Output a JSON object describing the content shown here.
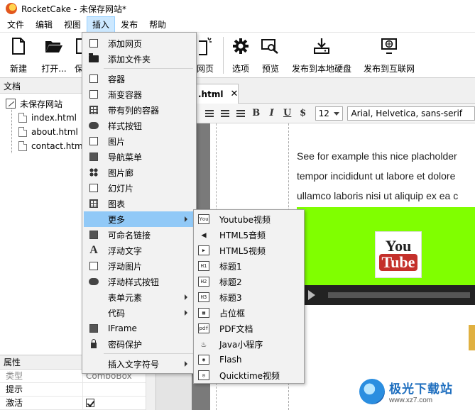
{
  "window": {
    "title": "RocketCake - 未保存网站*"
  },
  "menubar": {
    "items": [
      {
        "label": "文件",
        "active": false
      },
      {
        "label": "编辑",
        "active": false
      },
      {
        "label": "视图",
        "active": false
      },
      {
        "label": "插入",
        "active": true
      },
      {
        "label": "发布",
        "active": false
      },
      {
        "label": "帮助",
        "active": false
      }
    ]
  },
  "toolbar": {
    "new_label": "新建",
    "open_label": "打开...",
    "save_label_partial": "保",
    "webpage_label_partial": "网页",
    "options_label": "选项",
    "preview_label": "预览",
    "publish_local_label": "发布到本地硬盘",
    "publish_web_label": "发布到互联网"
  },
  "documents_panel": {
    "header": "文档",
    "root": "未保存网站",
    "files": [
      "index.html",
      "about.html",
      "contact.htm"
    ]
  },
  "properties_panel": {
    "header": "属性",
    "rows": [
      {
        "key": "类型",
        "value": "ComboBox"
      },
      {
        "key": "提示",
        "value": ""
      },
      {
        "key": "激活",
        "value": ""
      }
    ]
  },
  "editor": {
    "tab_label": ".html",
    "tab_close": "✕",
    "font_size": "12",
    "font_family": "Arial, Helvetica, sans-serif",
    "format_buttons": {
      "bold": "B",
      "italic": "I",
      "underline": "U",
      "dollar": "$"
    },
    "paragraph_lines": [
      "See for example this nice placholder",
      "tempor incididunt ut labore et dolore",
      "ullamco laboris nisi ut aliquip ex ea c"
    ],
    "youtube_logo": {
      "you": "You",
      "tube": "Tube"
    }
  },
  "insert_menu": {
    "items": [
      {
        "label": "添加网页",
        "icon": "add-page-icon",
        "has_submenu": false
      },
      {
        "label": "添加文件夹",
        "icon": "folder-icon",
        "has_submenu": false
      },
      {
        "label": "容器",
        "icon": "container-icon",
        "has_submenu": false
      },
      {
        "label": "渐变容器",
        "icon": "gradient-container-icon",
        "has_submenu": false
      },
      {
        "label": "带有列的容器",
        "icon": "column-container-icon",
        "has_submenu": false
      },
      {
        "label": "样式按钮",
        "icon": "style-button-icon",
        "has_submenu": false
      },
      {
        "label": "图片",
        "icon": "image-icon",
        "has_submenu": false
      },
      {
        "label": "导航菜单",
        "icon": "nav-menu-icon",
        "has_submenu": false
      },
      {
        "label": "图片廊",
        "icon": "gallery-icon",
        "has_submenu": false
      },
      {
        "label": "幻灯片",
        "icon": "slideshow-icon",
        "has_submenu": false
      },
      {
        "label": "图表",
        "icon": "table-icon",
        "has_submenu": false
      },
      {
        "label": "更多",
        "icon": "",
        "has_submenu": true,
        "highlighted": true
      },
      {
        "label": "可命名链接",
        "icon": "named-link-icon",
        "has_submenu": false
      },
      {
        "label": "浮动文字",
        "icon": "float-text-icon",
        "has_submenu": false
      },
      {
        "label": "浮动图片",
        "icon": "float-image-icon",
        "has_submenu": false
      },
      {
        "label": "浮动样式按钮",
        "icon": "float-button-icon",
        "has_submenu": false
      },
      {
        "label": "表单元素",
        "icon": "",
        "has_submenu": true
      },
      {
        "label": "代码",
        "icon": "",
        "has_submenu": true
      },
      {
        "label": "IFrame",
        "icon": "iframe-icon",
        "has_submenu": false
      },
      {
        "label": "密码保护",
        "icon": "lock-icon",
        "has_submenu": false
      },
      {
        "label": "插入文字符号",
        "icon": "",
        "has_submenu": true
      }
    ]
  },
  "more_submenu": {
    "items": [
      {
        "label": "Youtube视频",
        "icon_text": "You"
      },
      {
        "label": "HTML5音频",
        "icon_text": "◀"
      },
      {
        "label": "HTML5视频",
        "icon_text": "▶"
      },
      {
        "label": "标题1",
        "icon_text": "H1"
      },
      {
        "label": "标题2",
        "icon_text": "H2"
      },
      {
        "label": "标题3",
        "icon_text": "H3"
      },
      {
        "label": "占位框",
        "icon_text": "▦"
      },
      {
        "label": "PDF文档",
        "icon_text": "pdf"
      },
      {
        "label": "Java小程序",
        "icon_text": "♨"
      },
      {
        "label": "Flash",
        "icon_text": "◉"
      },
      {
        "label": "Quicktime视频",
        "icon_text": "◎"
      }
    ]
  },
  "watermark": {
    "cn": "极光下载站",
    "url": "www.xz7.com"
  },
  "colors": {
    "menu_highlight": "#91c9f7",
    "green_box": "#80ff00",
    "youtube_red": "#c4302b"
  }
}
